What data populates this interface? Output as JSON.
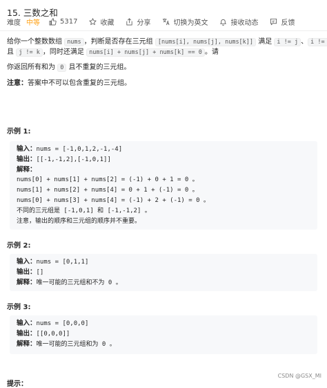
{
  "problem": {
    "title": "15. 三数之和",
    "difficulty_label": "难度",
    "difficulty": "中等",
    "likes": "5317",
    "collect": "收藏",
    "share": "分享",
    "switch_lang": "切换为英文",
    "notify": "接收动态",
    "feedback": "反馈"
  },
  "desc": {
    "line1_a": "给你一个整数数组",
    "line1_nums": "nums",
    "line1_b": "，判断是否存在三元组",
    "line1_triple": "[nums[i], nums[j], nums[k]]",
    "line1_c": "满足",
    "line1_cond1": "i != j",
    "line1_d": "、",
    "line1_cond2": "i != k",
    "line2_a": "且",
    "line2_cond3": "j != k",
    "line2_b": "，同时还满足",
    "line2_sum": "nums[i] + nums[j] + nums[k] == 0",
    "line2_c": "。请",
    "line3_a": "你返回所有和为",
    "line3_zero": "0",
    "line3_b": "且不重复的三元组。",
    "note_label": "注意：",
    "note_text": "答案中不可以包含重复的三元组。"
  },
  "examples": [
    {
      "title": "示例 1:",
      "lines": [
        {
          "label": "输入：",
          "text": "nums = [-1,0,1,2,-1,-4]"
        },
        {
          "label": "输出：",
          "text": "[[-1,-1,2],[-1,0,1]]"
        },
        {
          "label": "解释：",
          "text": ""
        },
        {
          "label": "",
          "text": "nums[0] + nums[1] + nums[2] = (-1) + 0 + 1 = 0 。"
        },
        {
          "label": "",
          "text": "nums[1] + nums[2] + nums[4] = 0 + 1 + (-1) = 0 。"
        },
        {
          "label": "",
          "text": "nums[0] + nums[3] + nums[4] = (-1) + 2 + (-1) = 0 。"
        },
        {
          "label": "",
          "text": "不同的三元组是 [-1,0,1] 和 [-1,-1,2] 。"
        },
        {
          "label": "",
          "text": "注意，输出的顺序和三元组的顺序并不重要。"
        }
      ]
    },
    {
      "title": "示例 2:",
      "lines": [
        {
          "label": "输入：",
          "text": "nums = [0,1,1]"
        },
        {
          "label": "输出：",
          "text": "[]"
        },
        {
          "label": "解释：",
          "text": "唯一可能的三元组和不为 0 。"
        }
      ]
    },
    {
      "title": "示例 3:",
      "lines": [
        {
          "label": "输入：",
          "text": "nums = [0,0,0]"
        },
        {
          "label": "输出：",
          "text": "[[0,0,0]]"
        },
        {
          "label": "解释：",
          "text": "唯一可能的三元组和为 0 。"
        }
      ]
    }
  ],
  "hint_label": "提示：",
  "watermark": "CSDN @GSX_MI"
}
